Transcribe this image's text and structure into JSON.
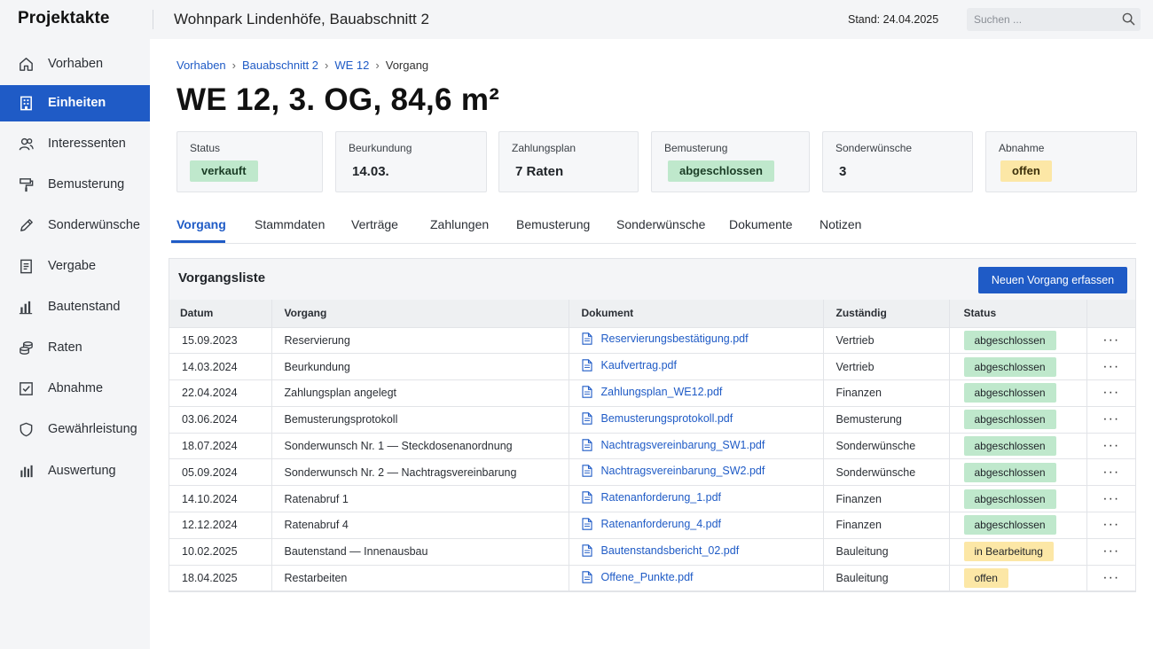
{
  "app": {
    "name": "Projektakte",
    "project_title": "Wohnpark Lindenhöfe, Bauabschnitt 2",
    "stand": "Stand: 24.04.2025",
    "search_placeholder": "Suchen ..."
  },
  "sidebar": {
    "items": [
      {
        "label": "Vorhaben",
        "icon": "home-icon"
      },
      {
        "label": "Einheiten",
        "icon": "building-icon",
        "active": true
      },
      {
        "label": "Interessenten",
        "icon": "users-icon"
      },
      {
        "label": "Bemusterung",
        "icon": "paint-roller-icon"
      },
      {
        "label": "Sonderwünsche",
        "icon": "pencil-icon"
      },
      {
        "label": "Vergabe",
        "icon": "document-list-icon"
      },
      {
        "label": "Bautenstand",
        "icon": "bar-chart-icon"
      },
      {
        "label": "Raten",
        "icon": "coins-icon"
      },
      {
        "label": "Abnahme",
        "icon": "checkbox-icon"
      },
      {
        "label": "Gewährleistung",
        "icon": "shield-icon"
      },
      {
        "label": "Auswertung",
        "icon": "stats-icon"
      }
    ]
  },
  "breadcrumb": {
    "items": [
      "Vorhaben",
      "Bauabschnitt 2",
      "WE 12"
    ],
    "current": "Vorgang"
  },
  "page_title": "WE 12, 3. OG, 84,6 m²",
  "summary_cards": [
    {
      "label": "Status",
      "value": "verkauft",
      "style": "green-pill"
    },
    {
      "label": "Beurkundung",
      "value": "14.03.",
      "style": "text"
    },
    {
      "label": "Zahlungsplan",
      "value": "7 Raten",
      "style": "text"
    },
    {
      "label": "Bemusterung",
      "value": "abgeschlossen",
      "style": "green-pill"
    },
    {
      "label": "Sonderwünsche",
      "value": "3",
      "style": "text"
    },
    {
      "label": "Abnahme",
      "value": "offen",
      "style": "yellow-pill"
    }
  ],
  "tabs": [
    {
      "label": "Vorgang",
      "active": true
    },
    {
      "label": "Stammdaten"
    },
    {
      "label": "Verträge"
    },
    {
      "label": "Zahlungen"
    },
    {
      "label": "Bemusterung"
    },
    {
      "label": "Sonderwünsche"
    },
    {
      "label": "Dokumente"
    },
    {
      "label": "Notizen"
    }
  ],
  "panel": {
    "title": "Vorgangsliste",
    "new_button": "Neuen Vorgang erfassen",
    "columns": [
      "Datum",
      "Vorgang",
      "Dokument",
      "Zuständig",
      "Status"
    ],
    "rows": [
      {
        "datum": "15.09.2023",
        "vorgang": "Reservierung",
        "dokument": "Reservierungsbestätigung.pdf",
        "zustaendig": "Vertrieb",
        "status": "abgeschlossen",
        "status_color": "green"
      },
      {
        "datum": "14.03.2024",
        "vorgang": "Beurkundung",
        "dokument": "Kaufvertrag.pdf",
        "zustaendig": "Vertrieb",
        "status": "abgeschlossen",
        "status_color": "green"
      },
      {
        "datum": "22.04.2024",
        "vorgang": "Zahlungsplan angelegt",
        "dokument": "Zahlungsplan_WE12.pdf",
        "zustaendig": "Finanzen",
        "status": "abgeschlossen",
        "status_color": "green"
      },
      {
        "datum": "03.06.2024",
        "vorgang": "Bemusterungsprotokoll",
        "dokument": "Bemusterungsprotokoll.pdf",
        "zustaendig": "Bemusterung",
        "status": "abgeschlossen",
        "status_color": "green"
      },
      {
        "datum": "18.07.2024",
        "vorgang": "Sonderwunsch Nr. 1 — Steckdosenanordnung",
        "dokument": "Nachtragsvereinbarung_SW1.pdf",
        "zustaendig": "Sonderwünsche",
        "status": "abgeschlossen",
        "status_color": "green"
      },
      {
        "datum": "05.09.2024",
        "vorgang": "Sonderwunsch Nr. 2 — Nachtragsvereinbarung",
        "dokument": "Nachtragsvereinbarung_SW2.pdf",
        "zustaendig": "Sonderwünsche",
        "status": "abgeschlossen",
        "status_color": "green"
      },
      {
        "datum": "14.10.2024",
        "vorgang": "Ratenabruf 1",
        "dokument": "Ratenanforderung_1.pdf",
        "zustaendig": "Finanzen",
        "status": "abgeschlossen",
        "status_color": "green"
      },
      {
        "datum": "12.12.2024",
        "vorgang": "Ratenabruf 4",
        "dokument": "Ratenanforderung_4.pdf",
        "zustaendig": "Finanzen",
        "status": "abgeschlossen",
        "status_color": "green"
      },
      {
        "datum": "10.02.2025",
        "vorgang": "Bautenstand — Innenausbau",
        "dokument": "Bautenstandsbericht_02.pdf",
        "zustaendig": "Bauleitung",
        "status": "in Bearbeitung",
        "status_color": "yellow"
      },
      {
        "datum": "18.04.2025",
        "vorgang": "Restarbeiten",
        "dokument": "Offene_Punkte.pdf",
        "zustaendig": "Bauleitung",
        "status": "offen",
        "status_color": "yellow"
      }
    ]
  },
  "colors": {
    "accent": "#1f5bc6",
    "status_green": "#bfe8cc",
    "status_yellow": "#fce7a6",
    "sidebar_bg": "#f4f5f7"
  }
}
